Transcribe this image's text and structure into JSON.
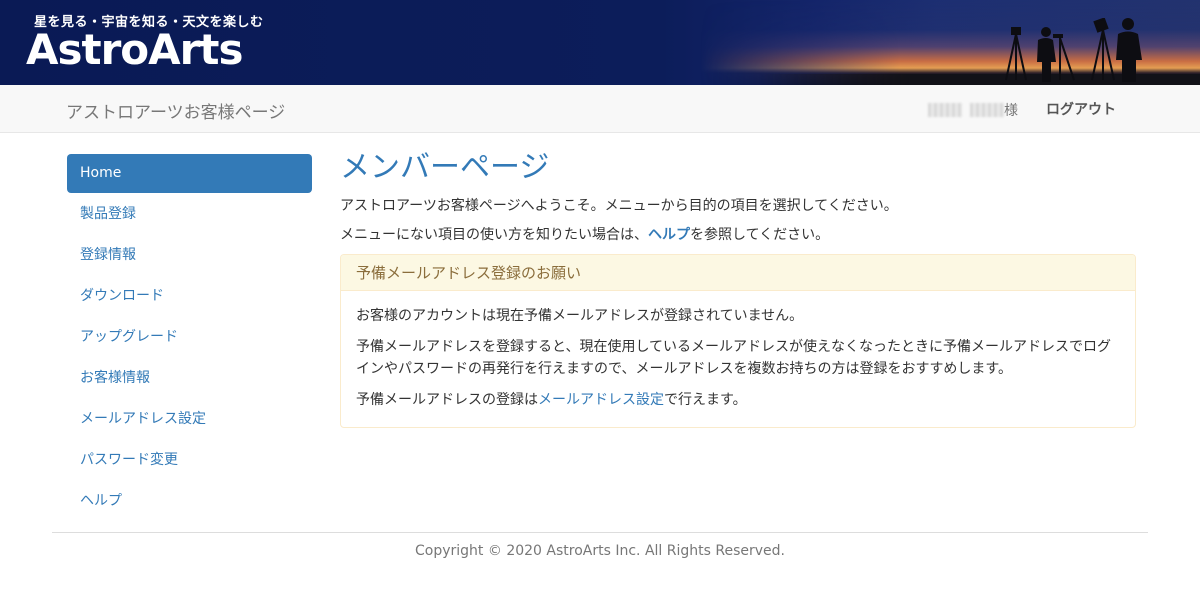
{
  "banner": {
    "tagline": "星を見る・宇宙を知る・天文を楽しむ",
    "logo_text": "AstroArts"
  },
  "navbar": {
    "brand": "アストロアーツお客様ページ",
    "user_suffix": "様",
    "logout_label": "ログアウト"
  },
  "sidebar": {
    "items": [
      {
        "label": "Home"
      },
      {
        "label": "製品登録"
      },
      {
        "label": "登録情報"
      },
      {
        "label": "ダウンロード"
      },
      {
        "label": "アップグレード"
      },
      {
        "label": "お客様情報"
      },
      {
        "label": "メールアドレス設定"
      },
      {
        "label": "パスワード変更"
      },
      {
        "label": "ヘルプ"
      }
    ]
  },
  "main": {
    "title": "メンバーページ",
    "intro1": "アストロアーツお客様ページへようこそ。メニューから目的の項目を選択してください。",
    "intro2_pre": "メニューにない項目の使い方を知りたい場合は、",
    "intro2_link": "ヘルプ",
    "intro2_post": "を参照してください。"
  },
  "panel": {
    "heading": "予備メールアドレス登録のお願い",
    "p1": "お客様のアカウントは現在予備メールアドレスが登録されていません。",
    "p2": "予備メールアドレスを登録すると、現在使用しているメールアドレスが使えなくなったときに予備メールアドレスでログインやパスワードの再発行を行えますので、メールアドレスを複数お持ちの方は登録をおすすめします。",
    "p3_pre": "予備メールアドレスの登録は",
    "p3_link": "メールアドレス設定",
    "p3_post": "で行えます。"
  },
  "footer": {
    "copyright": "Copyright © 2020 AstroArts Inc. All Rights Reserved."
  },
  "colors": {
    "accent": "#337ab7",
    "banner_bg": "#0c1d5a",
    "warning_heading_bg": "#fcf8e3",
    "warning_text": "#8a6d3b"
  }
}
